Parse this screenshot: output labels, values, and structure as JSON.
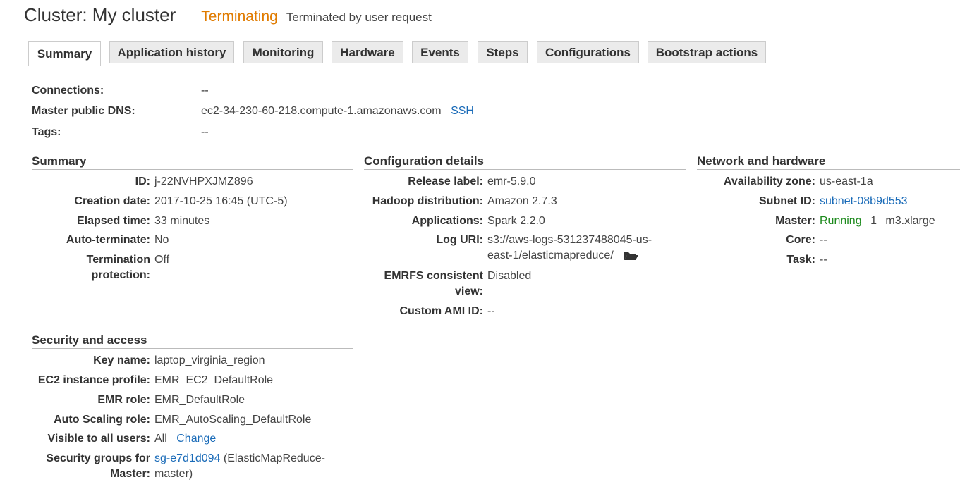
{
  "header": {
    "title": "Cluster: My cluster",
    "status": "Terminating",
    "status_reason": "Terminated by user request"
  },
  "tabs": [
    {
      "label": "Summary",
      "active": true
    },
    {
      "label": "Application history",
      "active": false
    },
    {
      "label": "Monitoring",
      "active": false
    },
    {
      "label": "Hardware",
      "active": false
    },
    {
      "label": "Events",
      "active": false
    },
    {
      "label": "Steps",
      "active": false
    },
    {
      "label": "Configurations",
      "active": false
    },
    {
      "label": "Bootstrap actions",
      "active": false
    }
  ],
  "top_info": {
    "connections_label": "Connections:",
    "connections_value": "--",
    "dns_label": "Master public DNS:",
    "dns_value": "ec2-34-230-60-218.compute-1.amazonaws.com",
    "ssh_link": "SSH",
    "tags_label": "Tags:",
    "tags_value": "--"
  },
  "summary": {
    "title": "Summary",
    "id_label": "ID:",
    "id_value": "j-22NVHPXJMZ896",
    "creation_label": "Creation date:",
    "creation_value": "2017-10-25 16:45 (UTC-5)",
    "elapsed_label": "Elapsed time:",
    "elapsed_value": "33 minutes",
    "autoterm_label": "Auto-terminate:",
    "autoterm_value": "No",
    "termprot_label_1": "Termination",
    "termprot_label_2": "protection:",
    "termprot_value": "Off"
  },
  "config": {
    "title": "Configuration details",
    "release_label": "Release label:",
    "release_value": "emr-5.9.0",
    "hadoop_label": "Hadoop distribution:",
    "hadoop_value": "Amazon 2.7.3",
    "apps_label": "Applications:",
    "apps_value": "Spark 2.2.0",
    "log_label": "Log URI:",
    "log_value_1": "s3://aws-logs-531237488045-us-",
    "log_value_2": "east-1/elasticmapreduce/",
    "emrfs_label_1": "EMRFS consistent",
    "emrfs_label_2": "view:",
    "emrfs_value": "Disabled",
    "ami_label": "Custom AMI ID:",
    "ami_value": "--"
  },
  "network": {
    "title": "Network and hardware",
    "az_label": "Availability zone:",
    "az_value": "us-east-1a",
    "subnet_label": "Subnet ID:",
    "subnet_value": "subnet-08b9d553",
    "master_label": "Master:",
    "master_status": "Running",
    "master_count": "1",
    "master_type": "m3.xlarge",
    "core_label": "Core:",
    "core_value": "--",
    "task_label": "Task:",
    "task_value": "--"
  },
  "security": {
    "title": "Security and access",
    "key_label": "Key name:",
    "key_value": "laptop_virginia_region",
    "profile_label": "EC2 instance profile:",
    "profile_value": "EMR_EC2_DefaultRole",
    "emr_role_label": "EMR role:",
    "emr_role_value": "EMR_DefaultRole",
    "autoscale_label": "Auto Scaling role:",
    "autoscale_value": "EMR_AutoScaling_DefaultRole",
    "visible_label": "Visible to all users:",
    "visible_value": "All",
    "change_link": "Change",
    "sg_label_1": "Security groups for",
    "sg_label_2": "Master:",
    "sg_link": "sg-e7d1d094",
    "sg_value_1": "(ElasticMapReduce-",
    "sg_value_2": "master)"
  },
  "colors": {
    "status_terminating": "#e07b00",
    "running": "#1d8a1d",
    "link": "#1a6bb8"
  }
}
